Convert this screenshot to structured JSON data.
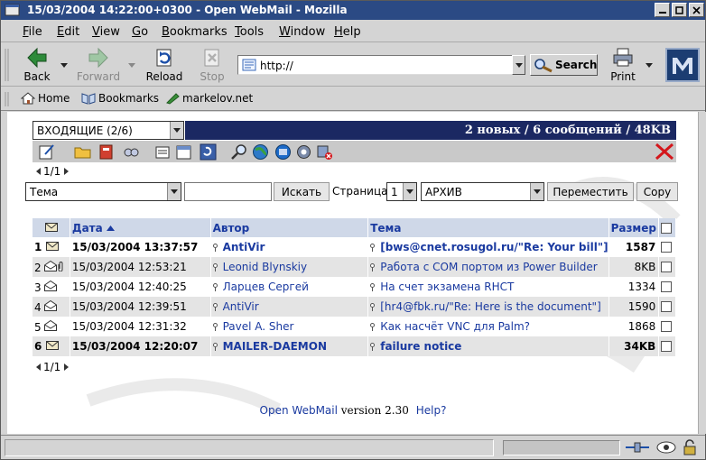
{
  "window": {
    "title": "15/03/2004 14:22:00+0300 - Open WebMail - Mozilla"
  },
  "menu": [
    "File",
    "Edit",
    "View",
    "Go",
    "Bookmarks",
    "Tools",
    "Window",
    "Help"
  ],
  "menu_mnemonics": [
    "F",
    "E",
    "V",
    "G",
    "B",
    "T",
    "W",
    "H"
  ],
  "nav": {
    "back": "Back",
    "forward": "Forward",
    "reload": "Reload",
    "stop": "Stop",
    "url": "http://",
    "search": "Search",
    "print": "Print"
  },
  "personal_toolbar": {
    "home": "Home",
    "bookmarks": "Bookmarks",
    "site": "markelov.net"
  },
  "mail": {
    "folder": "ВХОДЯЩИЕ (2/6)",
    "summary": "2 новых / 6 сообщений / 48KB",
    "page_top": "1/1",
    "page_bottom": "1/1",
    "search_field": "Тема",
    "search_value": "",
    "search_button": "Искать",
    "page_label": "Страница",
    "page_number": "1",
    "move_target": "АРХИВ",
    "move_button": "Переместить",
    "copy_button": "Copy"
  },
  "table": {
    "headers": {
      "date": "Дата",
      "author": "Автор",
      "subject": "Тема",
      "size": "Размер"
    },
    "rows": [
      {
        "num": "1",
        "status": "unread",
        "attach": false,
        "date": "15/03/2004 13:37:57",
        "author": "AntiVir",
        "subject": "[bws@cnet.rosugol.ru/\"Re: Your bill\"]",
        "size": "1587",
        "bold": true
      },
      {
        "num": "2",
        "status": "read",
        "attach": true,
        "date": "15/03/2004 12:53:21",
        "author": "Leonid Blynskiy",
        "subject": "Работа с COM портом из Power Builder",
        "size": "8KB",
        "bold": false
      },
      {
        "num": "3",
        "status": "read",
        "attach": false,
        "date": "15/03/2004 12:40:25",
        "author": "Ларцев Сергей",
        "subject": "На счет экзамена RHCT",
        "size": "1334",
        "bold": false
      },
      {
        "num": "4",
        "status": "read",
        "attach": false,
        "date": "15/03/2004 12:39:51",
        "author": "AntiVir",
        "subject": "[hr4@fbk.ru/\"Re: Here is the document\"]",
        "size": "1590",
        "bold": false
      },
      {
        "num": "5",
        "status": "read",
        "attach": false,
        "date": "15/03/2004 12:31:32",
        "author": "Pavel A. Sher",
        "subject": "Как насчёт VNC для Palm?",
        "size": "1868",
        "bold": false
      },
      {
        "num": "6",
        "status": "unread",
        "attach": false,
        "date": "15/03/2004 12:20:07",
        "author": "MAILER-DAEMON",
        "subject": "failure notice",
        "size": "34KB",
        "bold": true
      }
    ]
  },
  "footer": {
    "brand": "Open WebMail",
    "version": "version 2.30",
    "help": "Help?"
  },
  "colors": {
    "titlebar": "#2b4a84",
    "banner": "#1b2862",
    "link": "#1a3aa0",
    "header_row": "#cfd8e8",
    "close_x": "#d4161b"
  }
}
